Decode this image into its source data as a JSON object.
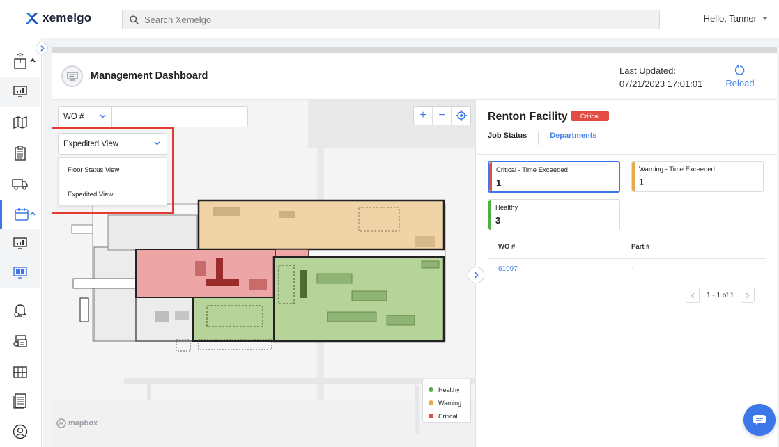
{
  "app": {
    "brand": "xemelgo",
    "accent": "#3b77e8"
  },
  "search": {
    "placeholder": "Search Xemelgo"
  },
  "user": {
    "greeting": "Hello, Tanner"
  },
  "sidebar": {
    "items": [
      {
        "icon": "package-rfid-icon",
        "expandable": true
      },
      {
        "icon": "dashboard-chart-icon"
      },
      {
        "icon": "map-icon"
      },
      {
        "icon": "clipboard-icon"
      },
      {
        "icon": "truck-icon"
      },
      {
        "icon": "calendar-icon",
        "expandable": true,
        "active": true
      },
      {
        "icon": "dashboard-chart-icon"
      },
      {
        "icon": "monitor-dashboard-icon"
      },
      {
        "icon": "bell-settings-icon"
      },
      {
        "icon": "inventory-settings-icon"
      },
      {
        "icon": "pallet-icon"
      },
      {
        "icon": "report-list-icon"
      },
      {
        "icon": "user-circle-icon"
      }
    ]
  },
  "header": {
    "title": "Management Dashboard",
    "last_updated_label": "Last Updated:",
    "last_updated_value": "07/21/2023 17:01:01",
    "reload_label": "Reload"
  },
  "map_controls": {
    "filter_label": "WO #",
    "filter_value": "",
    "view_selected": "Expedited View",
    "view_options": [
      "Floor Status View",
      "Expedited View"
    ],
    "zoom_in": "+",
    "zoom_out": "−"
  },
  "legend": [
    {
      "label": "Healthy",
      "color": "#4caf3f"
    },
    {
      "label": "Warning",
      "color": "#e8a84c"
    },
    {
      "label": "Critical",
      "color": "#e34c45"
    }
  ],
  "attribution": "mapbox",
  "facility": {
    "name": "Renton Facility",
    "status": "Critical",
    "tabs": [
      "Job Status",
      "Departments"
    ],
    "stats": [
      {
        "label": "Critical - Time Exceeded",
        "value": "1",
        "color": "#e34c45"
      },
      {
        "label": "Warning - Time Exceeded",
        "value": "1",
        "color": "#e8a84c"
      },
      {
        "label": "Healthy",
        "value": "3",
        "color": "#4caf3f"
      }
    ],
    "table": {
      "columns": [
        "WO #",
        "Part #"
      ],
      "rows": [
        {
          "wo": "61097",
          "part": "-"
        }
      ]
    },
    "pagination": "1 - 1 of 1"
  }
}
